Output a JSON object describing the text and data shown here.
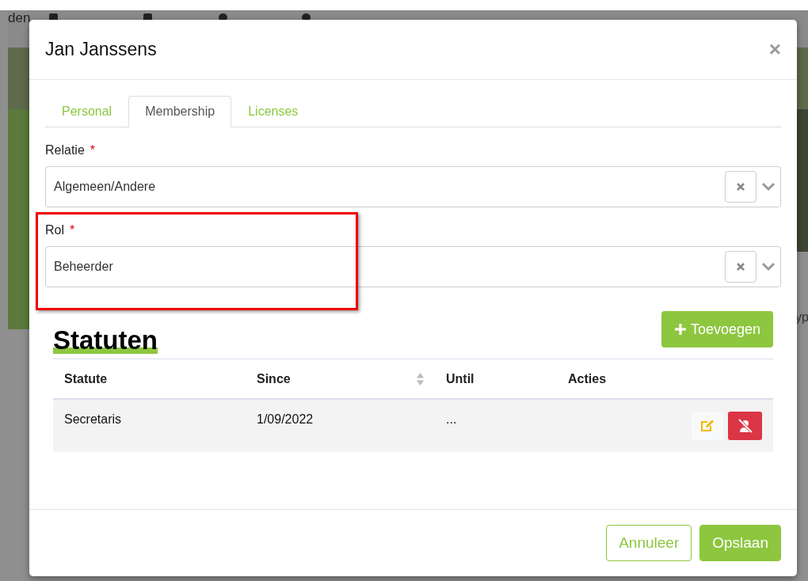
{
  "background": {
    "nav_text": "den",
    "side_text": "yp"
  },
  "modal": {
    "title": "Jan Janssens",
    "close": "×",
    "tabs": [
      {
        "label": "Personal",
        "selected": false
      },
      {
        "label": "Membership",
        "selected": true
      },
      {
        "label": "Licenses",
        "selected": false
      }
    ],
    "fields": [
      {
        "label": "Relatie",
        "required_mark": "*",
        "value": "Algemeen/Andere",
        "highlighted": false
      },
      {
        "label": "Rol",
        "required_mark": "*",
        "value": "Beheerder",
        "highlighted": true
      }
    ],
    "section_title": "Statuten",
    "add_button": "Toevoegen",
    "table": {
      "columns": [
        {
          "label": "Statute",
          "sortable": false
        },
        {
          "label": "Since",
          "sortable": true
        },
        {
          "label": "Until",
          "sortable": false
        },
        {
          "label": "Acties",
          "sortable": false
        }
      ],
      "rows": [
        {
          "cells": [
            "Secretaris",
            "1/09/2022",
            "..."
          ]
        }
      ]
    },
    "buttons": [
      {
        "label": "Annuleer",
        "kind": "secondary"
      },
      {
        "label": "Opslaan",
        "kind": "primary"
      }
    ]
  }
}
